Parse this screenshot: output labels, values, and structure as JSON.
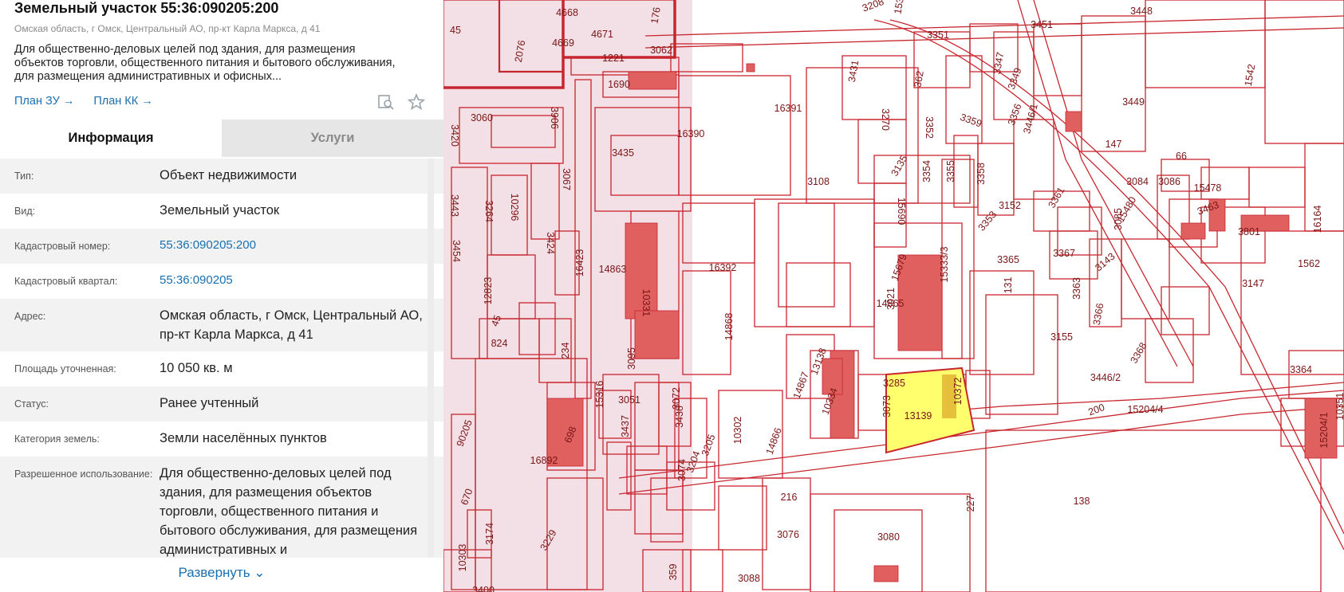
{
  "panel": {
    "title": "Земельный участок 55:36:090205:200",
    "address_line": "Омская область, г Омск, Центральный АО, пр-кт Карла Маркса, д 41",
    "description": "Для общественно-деловых целей под здания, для размещения объектов торговли, общественного питания и бытового обслуживания, для размещения административных и офисных...",
    "links": {
      "plan_zu": "План ЗУ →",
      "plan_kk": "План КК →"
    },
    "icons": [
      "search-document-icon",
      "star-icon"
    ],
    "tabs": {
      "info": "Информация",
      "services": "Услуги"
    },
    "rows": [
      {
        "label": "Тип:",
        "value": "Объект недвижимости"
      },
      {
        "label": "Вид:",
        "value": "Земельный участок"
      },
      {
        "label": "Кадастровый номер:",
        "value": "55:36:090205:200"
      },
      {
        "label": "Кадастровый квартал:",
        "value": "55:36:090205"
      },
      {
        "label": "Адрес:",
        "value": "Омская область, г Омск, Центральный АО, пр-кт Карла Маркса, д 41"
      },
      {
        "label": "Площадь уточненная:",
        "value": "10 050 кв. м"
      },
      {
        "label": "Статус:",
        "value": "Ранее учтенный"
      },
      {
        "label": "Категория земель:",
        "value": "Земли населённых пунктов"
      },
      {
        "label": "Разрешенное использование:",
        "value": "Для общественно-деловых целей под здания, для размещения объектов торговли, общественного питания и бытового обслуживания, для размещения административных и"
      }
    ],
    "expand_label": "Развернуть ⌄"
  },
  "map": {
    "colors": {
      "line": "#c8262e",
      "building": "#e06060",
      "selected": "#ffff6e",
      "quarter_tint": "#f3dfe6"
    },
    "labels": [
      "4668",
      "4669",
      "4671",
      "45",
      "2076",
      "1221",
      "1690",
      "3062",
      "176",
      "3208",
      "153",
      "3448",
      "3351",
      "3451",
      "3060",
      "3906",
      "3435",
      "16390",
      "16391",
      "3431",
      "3270",
      "362",
      "3349",
      "3347",
      "3449",
      "3420",
      "3067",
      "3135",
      "3108",
      "3352",
      "3359",
      "3356",
      "3446/1",
      "147",
      "66",
      "1542",
      "3443",
      "3264",
      "10296",
      "3454",
      "3424",
      "16423",
      "14863",
      "10331",
      "16392",
      "15690",
      "3354",
      "3355",
      "3358",
      "3152",
      "3353",
      "3361",
      "3084",
      "3086",
      "15478",
      "15480",
      "3463",
      "3085",
      "3801",
      "16164",
      "12823",
      "3021",
      "15679",
      "14865",
      "15333/3",
      "3365",
      "3367",
      "3363",
      "131",
      "3143",
      "3147",
      "1562",
      "45",
      "824",
      "234",
      "3095",
      "14868",
      "13138",
      "14867",
      "10334",
      "3285",
      "10372",
      "3155",
      "3366",
      "3368",
      "3446/2",
      "3364",
      "15204/1",
      "10351",
      "15316",
      "3051",
      "3437",
      "3438",
      "3072",
      "3073",
      "13139",
      "200",
      "15204/4",
      "90205",
      "698",
      "16892",
      "10302",
      "3205",
      "14866",
      "3074",
      "3204",
      "670",
      "3174",
      "227",
      "216",
      "138",
      "3080",
      "3076",
      "3229",
      "10303",
      "3400",
      "359",
      "3088"
    ]
  }
}
